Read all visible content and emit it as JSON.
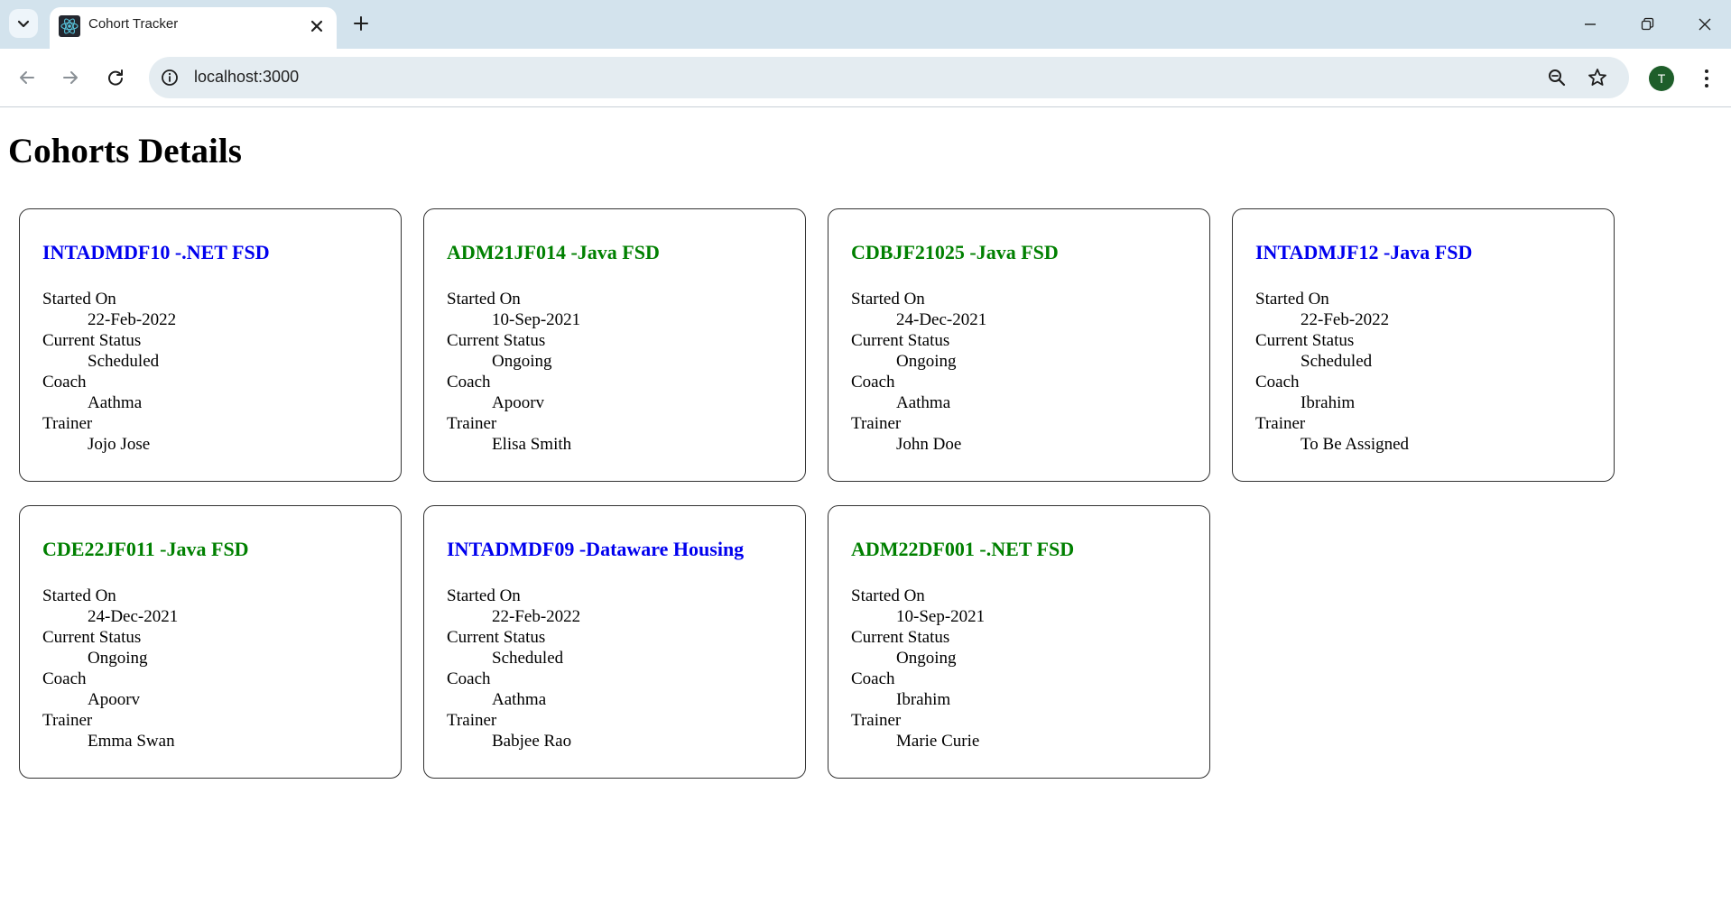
{
  "browser": {
    "tab_title": "Cohort Tracker",
    "url": "localhost:3000",
    "profile_initial": "T"
  },
  "colors": {
    "scheduled": "#0000ee",
    "ongoing": "#008000"
  },
  "page": {
    "title": "Cohorts Details",
    "labels": {
      "started_on": "Started On",
      "current_status": "Current Status",
      "coach": "Coach",
      "trainer": "Trainer"
    },
    "cohorts": [
      {
        "title": "INTADMDF10 -.NET FSD",
        "started_on": "22-Feb-2022",
        "status": "Scheduled",
        "coach": "Aathma",
        "trainer": "Jojo Jose"
      },
      {
        "title": "ADM21JF014 -Java FSD",
        "started_on": "10-Sep-2021",
        "status": "Ongoing",
        "coach": "Apoorv",
        "trainer": "Elisa Smith"
      },
      {
        "title": "CDBJF21025 -Java FSD",
        "started_on": "24-Dec-2021",
        "status": "Ongoing",
        "coach": "Aathma",
        "trainer": "John Doe"
      },
      {
        "title": "INTADMJF12 -Java FSD",
        "started_on": "22-Feb-2022",
        "status": "Scheduled",
        "coach": "Ibrahim",
        "trainer": "To Be Assigned"
      },
      {
        "title": "CDE22JF011 -Java FSD",
        "started_on": "24-Dec-2021",
        "status": "Ongoing",
        "coach": "Apoorv",
        "trainer": "Emma Swan"
      },
      {
        "title": "INTADMDF09 -Dataware Housing",
        "started_on": "22-Feb-2022",
        "status": "Scheduled",
        "coach": "Aathma",
        "trainer": "Babjee Rao"
      },
      {
        "title": "ADM22DF001 -.NET FSD",
        "started_on": "10-Sep-2021",
        "status": "Ongoing",
        "coach": "Ibrahim",
        "trainer": "Marie Curie"
      }
    ]
  }
}
